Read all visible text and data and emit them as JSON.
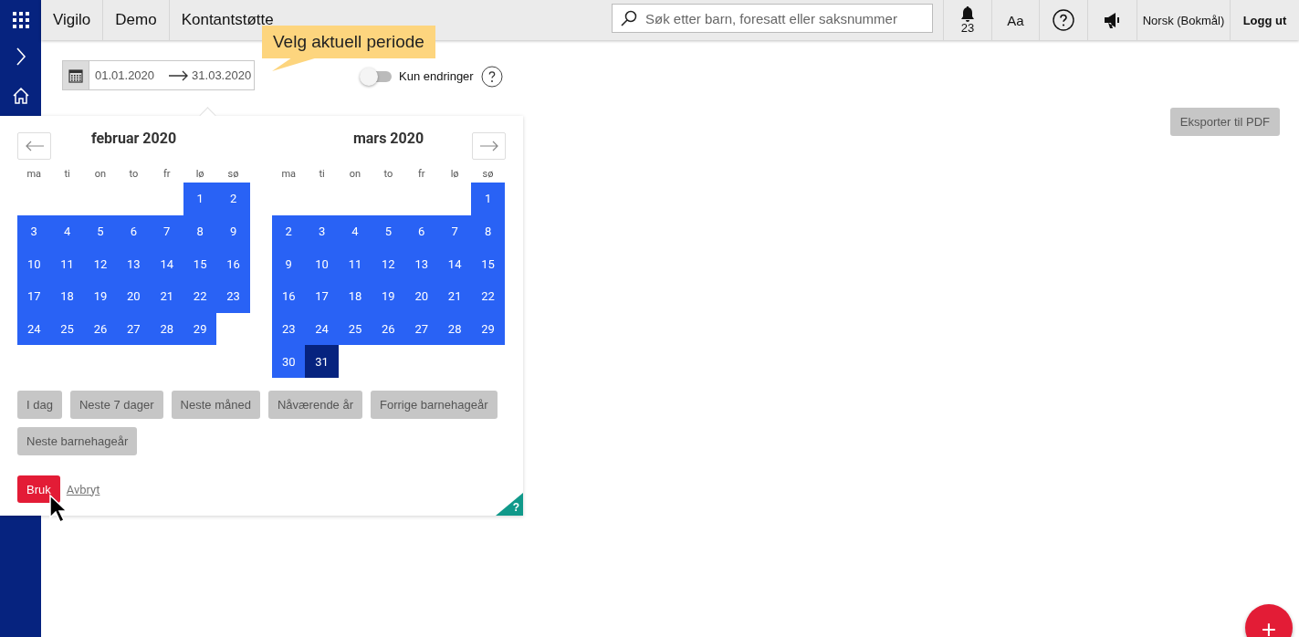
{
  "topbar": {
    "brand": "Vigilo",
    "nav": [
      "Demo",
      "Kontantstøtte"
    ],
    "search": {
      "placeholder": "Søk etter barn, foresatt eller saksnummer"
    },
    "notifications": {
      "count": "23"
    },
    "font_button": "Aa",
    "language": "Norsk (Bokmål)",
    "logout": "Logg ut"
  },
  "tooltip": "Velg aktuell periode",
  "period": {
    "from": "01.01.2020",
    "to": "31.03.2020"
  },
  "changes_only": {
    "label": "Kun endringer",
    "on": false
  },
  "export_button": "Eksporter til PDF",
  "datepicker": {
    "months": [
      {
        "title": "februar 2020",
        "weekdays": [
          "ma",
          "ti",
          "on",
          "to",
          "fr",
          "lø",
          "sø"
        ],
        "weeks": [
          [
            {
              "kind": "blank"
            },
            {
              "kind": "blank"
            },
            {
              "kind": "blank"
            },
            {
              "kind": "blank"
            },
            {
              "kind": "blank"
            },
            {
              "day": "1",
              "kind": "range"
            },
            {
              "day": "2",
              "kind": "range"
            }
          ],
          [
            {
              "day": "3",
              "kind": "range"
            },
            {
              "day": "4",
              "kind": "range"
            },
            {
              "day": "5",
              "kind": "range"
            },
            {
              "day": "6",
              "kind": "range"
            },
            {
              "day": "7",
              "kind": "range"
            },
            {
              "day": "8",
              "kind": "range"
            },
            {
              "day": "9",
              "kind": "range"
            }
          ],
          [
            {
              "day": "10",
              "kind": "range"
            },
            {
              "day": "11",
              "kind": "range"
            },
            {
              "day": "12",
              "kind": "range"
            },
            {
              "day": "13",
              "kind": "range"
            },
            {
              "day": "14",
              "kind": "range"
            },
            {
              "day": "15",
              "kind": "range"
            },
            {
              "day": "16",
              "kind": "range"
            }
          ],
          [
            {
              "day": "17",
              "kind": "range"
            },
            {
              "day": "18",
              "kind": "range"
            },
            {
              "day": "19",
              "kind": "range"
            },
            {
              "day": "20",
              "kind": "range"
            },
            {
              "day": "21",
              "kind": "range"
            },
            {
              "day": "22",
              "kind": "range"
            },
            {
              "day": "23",
              "kind": "range"
            }
          ],
          [
            {
              "day": "24",
              "kind": "range"
            },
            {
              "day": "25",
              "kind": "range"
            },
            {
              "day": "26",
              "kind": "range"
            },
            {
              "day": "27",
              "kind": "range"
            },
            {
              "day": "28",
              "kind": "range"
            },
            {
              "day": "29",
              "kind": "range"
            }
          ]
        ]
      },
      {
        "title": "mars 2020",
        "weekdays": [
          "ma",
          "ti",
          "on",
          "to",
          "fr",
          "lø",
          "sø"
        ],
        "weeks": [
          [
            {
              "kind": "blank"
            },
            {
              "kind": "blank"
            },
            {
              "kind": "blank"
            },
            {
              "kind": "blank"
            },
            {
              "kind": "blank"
            },
            {
              "kind": "blank"
            },
            {
              "day": "1",
              "kind": "range"
            }
          ],
          [
            {
              "day": "2",
              "kind": "range"
            },
            {
              "day": "3",
              "kind": "range"
            },
            {
              "day": "4",
              "kind": "range"
            },
            {
              "day": "5",
              "kind": "range"
            },
            {
              "day": "6",
              "kind": "range"
            },
            {
              "day": "7",
              "kind": "range"
            },
            {
              "day": "8",
              "kind": "range"
            }
          ],
          [
            {
              "day": "9",
              "kind": "range"
            },
            {
              "day": "10",
              "kind": "range"
            },
            {
              "day": "11",
              "kind": "range"
            },
            {
              "day": "12",
              "kind": "range"
            },
            {
              "day": "13",
              "kind": "range"
            },
            {
              "day": "14",
              "kind": "range"
            },
            {
              "day": "15",
              "kind": "range"
            }
          ],
          [
            {
              "day": "16",
              "kind": "range"
            },
            {
              "day": "17",
              "kind": "range"
            },
            {
              "day": "18",
              "kind": "range"
            },
            {
              "day": "19",
              "kind": "range"
            },
            {
              "day": "20",
              "kind": "range"
            },
            {
              "day": "21",
              "kind": "range"
            },
            {
              "day": "22",
              "kind": "range"
            }
          ],
          [
            {
              "day": "23",
              "kind": "range"
            },
            {
              "day": "24",
              "kind": "range"
            },
            {
              "day": "25",
              "kind": "range"
            },
            {
              "day": "26",
              "kind": "range"
            },
            {
              "day": "27",
              "kind": "range"
            },
            {
              "day": "28",
              "kind": "range"
            },
            {
              "day": "29",
              "kind": "range"
            }
          ],
          [
            {
              "day": "30",
              "kind": "range"
            },
            {
              "day": "31",
              "kind": "range-end"
            }
          ]
        ]
      }
    ],
    "presets": [
      "I dag",
      "Neste 7 dager",
      "Neste måned",
      "Nåværende år",
      "Forrige barnehageår",
      "Neste barnehageår"
    ],
    "apply": "Bruk",
    "cancel": "Avbryt",
    "help": "?"
  },
  "fab": "+"
}
